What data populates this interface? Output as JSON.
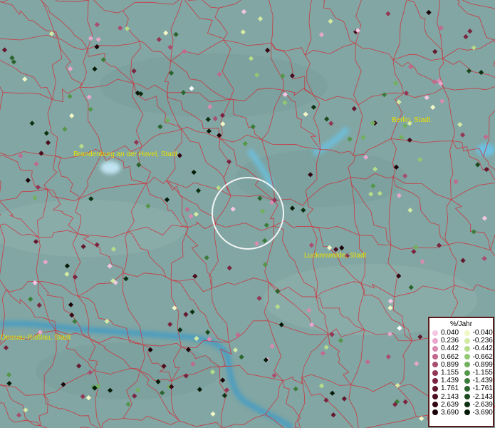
{
  "city_labels": {
    "berlin": "Berlin, Stadt",
    "brandenburg": "Brandenburg an der Havel, Stadt",
    "luckenwalde": "Luckenwalde, Stadt",
    "dessau": "Dessau-Roßlau, Stadt"
  },
  "legend": {
    "title": "%/Jahr",
    "positive": [
      {
        "label": "0.040",
        "color": "#f4c6e4"
      },
      {
        "label": "0.236",
        "color": "#e9a6cc"
      },
      {
        "label": "0.442",
        "color": "#d98bb0"
      },
      {
        "label": "0.662",
        "color": "#c2698e"
      },
      {
        "label": "0.899",
        "color": "#a94d70"
      },
      {
        "label": "1.155",
        "color": "#923755"
      },
      {
        "label": "1.439",
        "color": "#7a2440"
      },
      {
        "label": "1.761",
        "color": "#63182e"
      },
      {
        "label": "2.143",
        "color": "#4b0e1e"
      },
      {
        "label": "2.639",
        "color": "#330711"
      },
      {
        "label": "3.690",
        "color": "#1a0207"
      }
    ],
    "negative": [
      {
        "label": "-0.040",
        "color": "#f1f7c6"
      },
      {
        "label": "-0.236",
        "color": "#d3eaa4"
      },
      {
        "label": "-0.442",
        "color": "#b5dc8b"
      },
      {
        "label": "-0.662",
        "color": "#93c872"
      },
      {
        "label": "-0.899",
        "color": "#72b05b"
      },
      {
        "label": "-1.155",
        "color": "#54964a"
      },
      {
        "label": "-1.439",
        "color": "#3c7c3a"
      },
      {
        "label": "-1.761",
        "color": "#2a632c"
      },
      {
        "label": "-2.143",
        "color": "#1b4a1f"
      },
      {
        "label": "-2.639",
        "color": "#0f3213"
      },
      {
        "label": "-3.690",
        "color": "#051a07"
      }
    ]
  }
}
